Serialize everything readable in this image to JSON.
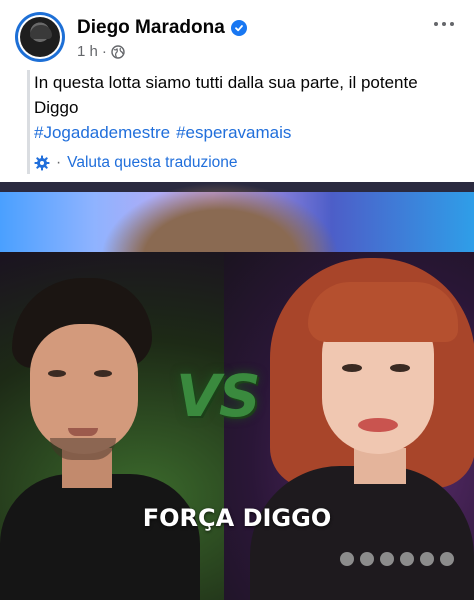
{
  "post": {
    "author": "Diego Maradona",
    "time": "1 h",
    "dot": "·",
    "caption": "In questa lotta siamo tutti dalla sua parte, il potente Diggo",
    "hashtags": [
      "#Jogadademestre",
      "#esperavamais"
    ],
    "translate_link": "Valuta questa traduzione",
    "translate_sep": "·"
  },
  "media": {
    "vs_text": "VS",
    "overlay_caption": "FORÇA DIGGO"
  },
  "icons": {
    "verified": "verified-badge-icon",
    "privacy": "globe-icon",
    "more": "more-horizontal-icon",
    "translate": "gear-icon"
  },
  "colors": {
    "link": "#216fdb",
    "meta": "#65676b",
    "verified": "#1877f2"
  }
}
